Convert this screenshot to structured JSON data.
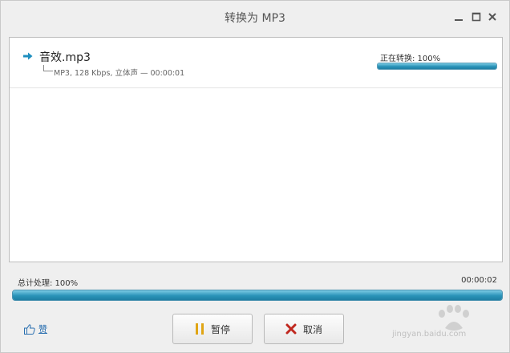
{
  "window": {
    "title": "转换为 MP3"
  },
  "file": {
    "name": "音效.mp3",
    "info": "MP3, 128 Kbps, 立体声 — 00:00:01",
    "status": "正在转换: 100%",
    "progress": 1.0
  },
  "total": {
    "label": "总计处理: 100%",
    "time": "00:00:02",
    "progress": 1.0
  },
  "footer": {
    "like_label": "赞",
    "pause_label": "暂停",
    "cancel_label": "取消"
  },
  "watermark": {
    "text": "jingyan.baidu.com"
  },
  "colors": {
    "progress": "#2a93b8",
    "accent": "#1f8fbf",
    "cancel_icon": "#c0281f",
    "pause_icon": "#e0a514"
  }
}
